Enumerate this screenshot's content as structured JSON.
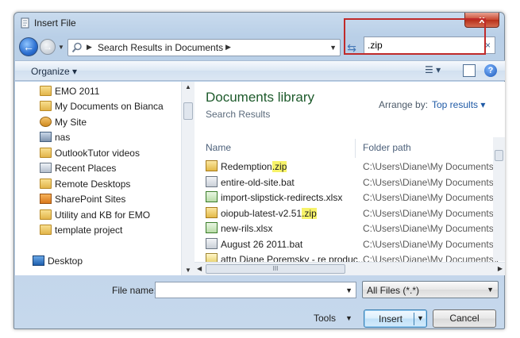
{
  "window": {
    "title": "Insert File",
    "close_glyph": "x"
  },
  "nav": {
    "back_glyph": "←",
    "forward_glyph": "→",
    "address_crumb": "Search Results in Documents",
    "search_value": ".zip",
    "clear_glyph": "×"
  },
  "toolbar": {
    "organize_label": "Organize",
    "help_glyph": "?"
  },
  "sidebar": {
    "items": [
      {
        "label": "EMO 2011",
        "icon": "folder-icon"
      },
      {
        "label": "My Documents on Bianca",
        "icon": "folder-icon"
      },
      {
        "label": "My Site",
        "icon": "site-icon"
      },
      {
        "label": "nas",
        "icon": "network-drive-icon"
      },
      {
        "label": "OutlookTutor videos",
        "icon": "folder-icon"
      },
      {
        "label": "Recent Places",
        "icon": "recent-places-icon"
      },
      {
        "label": "Remote Desktops",
        "icon": "folder-icon"
      },
      {
        "label": "SharePoint Sites",
        "icon": "sharepoint-icon"
      },
      {
        "label": "Utility and KB for EMO",
        "icon": "folder-icon"
      },
      {
        "label": "template project",
        "icon": "folder-icon"
      },
      {
        "label": "Desktop",
        "icon": "desktop-icon"
      }
    ]
  },
  "library": {
    "title": "Documents library",
    "subtitle": "Search Results",
    "arrange_label": "Arrange by:",
    "arrange_value": "Top results"
  },
  "columns": {
    "name": "Name",
    "path": "Folder path"
  },
  "files": [
    {
      "name_pre": "Redemption",
      "name_hl": ".zip",
      "path": "C:\\Users\\Diane\\My Documents\\Util",
      "icon": "zip-icon"
    },
    {
      "name_pre": "entire-old-site.bat",
      "name_hl": "",
      "path": "C:\\Users\\Diane\\My Documents\\Util",
      "icon": "bat-icon"
    },
    {
      "name_pre": "import-slipstick-redirects.xlsx",
      "name_hl": "",
      "path": "C:\\Users\\Diane\\My Documents\\Tes",
      "icon": "xlsx-icon"
    },
    {
      "name_pre": "oiopub-latest-v2.51",
      "name_hl": ".zip",
      "path": "C:\\Users\\Diane\\My Documents\\Util",
      "icon": "zip-icon"
    },
    {
      "name_pre": "new-rils.xlsx",
      "name_hl": "",
      "path": "C:\\Users\\Diane\\My Documents",
      "icon": "xlsx-icon"
    },
    {
      "name_pre": "August 26 2011.bat",
      "name_hl": "",
      "path": "C:\\Users\\Diane\\My Documents\\Util",
      "icon": "bat-icon"
    },
    {
      "name_pre": "attn  Diane Poremsky - re produc...",
      "name_hl": "",
      "path": "C:\\Users\\Diane\\My Documents\\Fax",
      "icon": "message-icon"
    }
  ],
  "scroll": {
    "thumb_grip": "III"
  },
  "bottom": {
    "file_name_label": "File name:",
    "file_name_value": "",
    "file_type_value": "All Files (*.*)",
    "tools_label": "Tools",
    "insert_label": "Insert",
    "cancel_label": "Cancel"
  },
  "colors": {
    "accent_red": "#c02a2a",
    "library_green": "#1e5b2c",
    "link_blue": "#1f5aa6"
  }
}
